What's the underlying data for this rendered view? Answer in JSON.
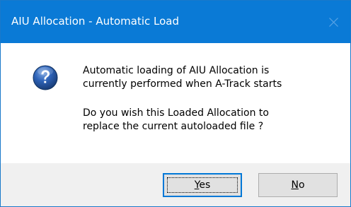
{
  "window": {
    "title": "AIU Allocation - Automatic Load"
  },
  "message": {
    "line1": "Automatic loading of AIU Allocation is",
    "line2": "currently performed when A-Track starts",
    "line3": "Do you wish this Loaded Allocation to",
    "line4": "replace the current autoloaded file ?"
  },
  "buttons": {
    "yes": {
      "mnemonic": "Y",
      "rest": "es"
    },
    "no": {
      "mnemonic": "N",
      "rest": "o"
    }
  },
  "icons": {
    "dialog": "question-icon",
    "close": "close-icon"
  },
  "colors": {
    "titlebar": "#0a7ad6",
    "title_text": "#ffffff",
    "footer": "#f0f0f0",
    "button_face": "#e1e1e1",
    "default_button_border": "#0078d7",
    "icon_blue": "#1f4f9c"
  }
}
